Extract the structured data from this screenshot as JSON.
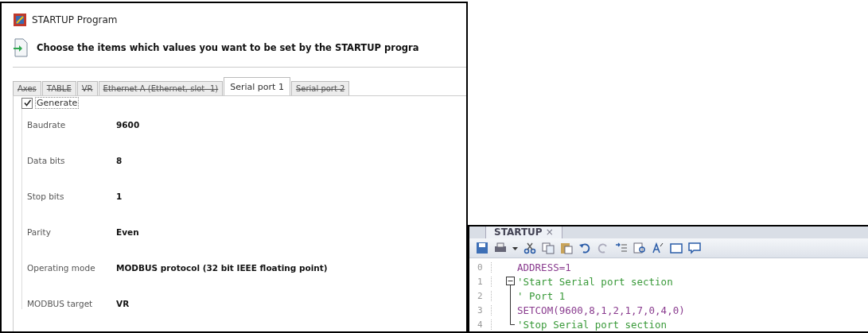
{
  "dialog": {
    "title": "STARTUP Program",
    "instruction": "Choose the items which values you want to be set by the STARTUP progra",
    "tabs": [
      {
        "label": "Axes",
        "selected": false,
        "disabled": true
      },
      {
        "label": "TABLE",
        "selected": false,
        "disabled": true
      },
      {
        "label": "VR",
        "selected": false,
        "disabled": true
      },
      {
        "label": "Ethernet A (Ethernet, slot -1)",
        "selected": false,
        "disabled": true
      },
      {
        "label": "Serial port 1",
        "selected": true,
        "disabled": false
      },
      {
        "label": "Serial port 2",
        "selected": false,
        "disabled": true
      }
    ],
    "generate": {
      "label": "Generate",
      "checked": true
    },
    "fields": [
      {
        "label": "Baudrate",
        "value": "9600"
      },
      {
        "label": "Data bits",
        "value": "8"
      },
      {
        "label": "Stop bits",
        "value": "1"
      },
      {
        "label": "Parity",
        "value": "Even"
      },
      {
        "label": "Operating mode",
        "value": "MODBUS protocol (32 bit IEEE floating point)"
      },
      {
        "label": "MODBUS target",
        "value": "VR"
      }
    ]
  },
  "editor": {
    "tab": {
      "label": "STARTUP",
      "close": "×"
    },
    "lines": [
      {
        "number": "0",
        "text": "ADDRESS=1",
        "kind": "code",
        "fold_start": false,
        "in_fold": false,
        "fold_end": false
      },
      {
        "number": "1",
        "text": "'Start Serial port section",
        "kind": "comment",
        "fold_start": true,
        "in_fold": false,
        "fold_end": false
      },
      {
        "number": "2",
        "text": "' Port 1",
        "kind": "comment",
        "fold_start": false,
        "in_fold": true,
        "fold_end": false
      },
      {
        "number": "3",
        "text": "SETCOM(9600,8,1,2,1,7,0,4,0)",
        "kind": "code",
        "fold_start": false,
        "in_fold": true,
        "fold_end": false
      },
      {
        "number": "4",
        "text": "'Stop Serial port section",
        "kind": "comment",
        "fold_start": false,
        "in_fold": false,
        "fold_end": true
      }
    ]
  }
}
